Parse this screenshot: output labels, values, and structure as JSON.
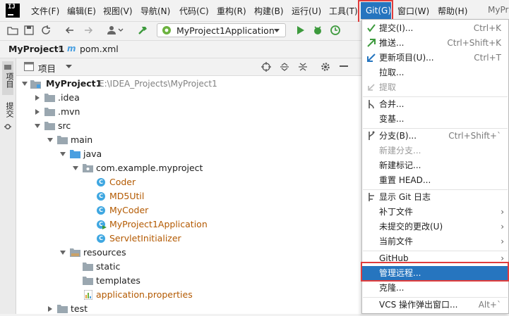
{
  "app": {
    "logo_text": "IJ"
  },
  "menu": [
    "文件(F)",
    "编辑(E)",
    "视图(V)",
    "导航(N)",
    "代码(C)",
    "重构(R)",
    "构建(B)",
    "运行(U)",
    "工具(T)",
    "Git(G)",
    "窗口(W)",
    "帮助(H)"
  ],
  "window_title_partial": "MyPr",
  "toolbar": {
    "run_config": "MyProject1Application"
  },
  "breadcrumb": {
    "project": "MyProject1",
    "file": "pom.xml"
  },
  "left_strip": {
    "project_tab": "项目",
    "commit_tab": "提交"
  },
  "project_panel": {
    "title": "项目"
  },
  "tree": [
    {
      "label": "MyProject1",
      "path": "E:\\IDEA_Projects\\MyProject1",
      "kind": "module",
      "depth": 0,
      "expanded": true
    },
    {
      "label": ".idea",
      "kind": "folder",
      "depth": 1,
      "expanded": false
    },
    {
      "label": ".mvn",
      "kind": "folder",
      "depth": 1,
      "expanded": false
    },
    {
      "label": "src",
      "kind": "folder",
      "depth": 1,
      "expanded": true
    },
    {
      "label": "main",
      "kind": "folder",
      "depth": 2,
      "expanded": true
    },
    {
      "label": "java",
      "kind": "source-folder",
      "depth": 3,
      "expanded": true
    },
    {
      "label": "com.example.myproject",
      "kind": "package",
      "depth": 4,
      "expanded": true
    },
    {
      "label": "Coder",
      "kind": "class",
      "depth": 5,
      "color": "#b35900"
    },
    {
      "label": "MD5Util",
      "kind": "class",
      "depth": 5,
      "color": "#b35900"
    },
    {
      "label": "MyCoder",
      "kind": "class",
      "depth": 5,
      "color": "#b35900"
    },
    {
      "label": "MyProject1Application",
      "kind": "class-main",
      "depth": 5,
      "color": "#b35900"
    },
    {
      "label": "ServletInitializer",
      "kind": "class",
      "depth": 5,
      "color": "#b35900"
    },
    {
      "label": "resources",
      "kind": "resource-folder",
      "depth": 3,
      "expanded": true
    },
    {
      "label": "static",
      "kind": "folder",
      "depth": 4
    },
    {
      "label": "templates",
      "kind": "folder",
      "depth": 4
    },
    {
      "label": "application.properties",
      "kind": "properties",
      "depth": 4,
      "color": "#b35900"
    },
    {
      "label": "test",
      "kind": "folder",
      "depth": 2,
      "expanded": false
    }
  ],
  "git_menu": {
    "items": [
      {
        "label": "提交(I)...",
        "shortcut": "Ctrl+K",
        "icon": "commit-check-icon"
      },
      {
        "label": "推送...",
        "shortcut": "Ctrl+Shift+K",
        "icon": "push-arrow-icon"
      },
      {
        "label": "更新项目(U)...",
        "shortcut": "Ctrl+T",
        "icon": "update-arrow-icon"
      },
      {
        "label": "拉取...",
        "shortcut": ""
      },
      {
        "label": "提取",
        "shortcut": "",
        "disabled": true,
        "icon": "fetch-icon"
      },
      {
        "sep": true
      },
      {
        "label": "合并...",
        "shortcut": "",
        "icon": "merge-icon"
      },
      {
        "label": "变基...",
        "shortcut": ""
      },
      {
        "sep": true
      },
      {
        "label": "分支(B)...",
        "shortcut": "Ctrl+Shift+`",
        "icon": "branch-icon"
      },
      {
        "label": "新建分支...",
        "shortcut": "",
        "disabled": true
      },
      {
        "label": "新建标记...",
        "shortcut": ""
      },
      {
        "label": "重置 HEAD...",
        "shortcut": ""
      },
      {
        "sep": true
      },
      {
        "label": "显示 Git 日志",
        "shortcut": "",
        "icon": "log-icon"
      },
      {
        "label": "补丁文件",
        "shortcut": "",
        "submenu": true
      },
      {
        "label": "未提交的更改(U)",
        "shortcut": "",
        "submenu": true
      },
      {
        "label": "当前文件",
        "shortcut": "",
        "submenu": true
      },
      {
        "sep": true
      },
      {
        "label": "GitHub",
        "shortcut": "",
        "submenu": true
      },
      {
        "label": "管理远程...",
        "shortcut": "",
        "highlighted": true
      },
      {
        "label": "克隆...",
        "shortcut": ""
      },
      {
        "sep": true
      },
      {
        "label": "VCS 操作弹出窗口...",
        "shortcut": "Alt+`"
      }
    ]
  },
  "colors": {
    "accent": "#2675bf",
    "highlight_box": "#e03c3c",
    "class_icon": "#3fa7e1",
    "class_text": "#b35900",
    "folder": "#9aa7b0",
    "source_folder": "#4a9fe0",
    "run_green": "#3d9a3d"
  }
}
